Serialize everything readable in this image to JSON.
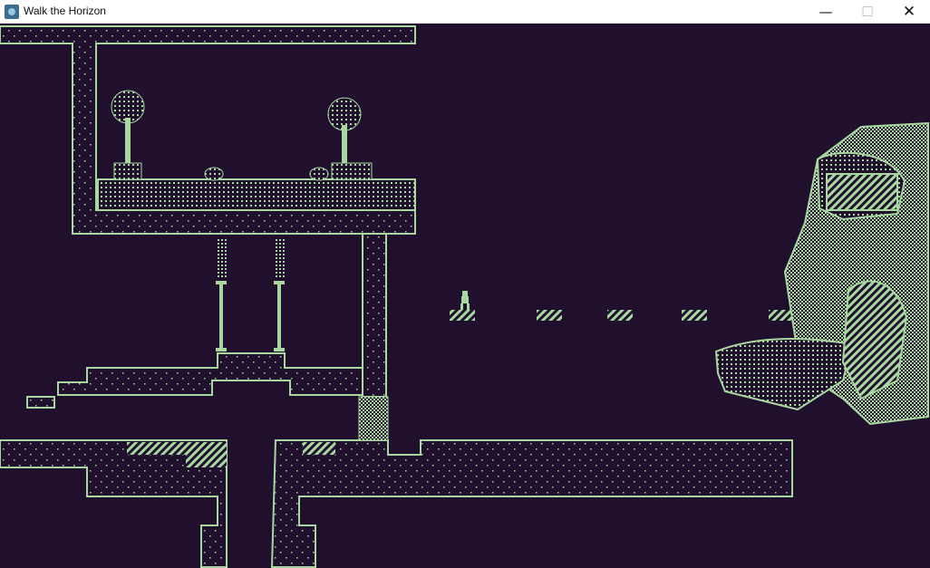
{
  "window": {
    "title": "Walk the Horizon",
    "app_icon": "app-icon",
    "controls": {
      "minimize_glyph": "—",
      "maximize_glyph": "☐",
      "close_glyph": "✕"
    }
  },
  "palette": {
    "background": "#20102e",
    "foreground": "#a8d8a0",
    "titlebar": "#ffffff"
  },
  "scene": {
    "player": "player-character",
    "objects": [
      "tree-left",
      "tree-right",
      "shrub-left",
      "shrub-right",
      "pillar-left",
      "pillar-right",
      "checkered-door",
      "floating-platforms",
      "giant-knight-statue"
    ]
  }
}
